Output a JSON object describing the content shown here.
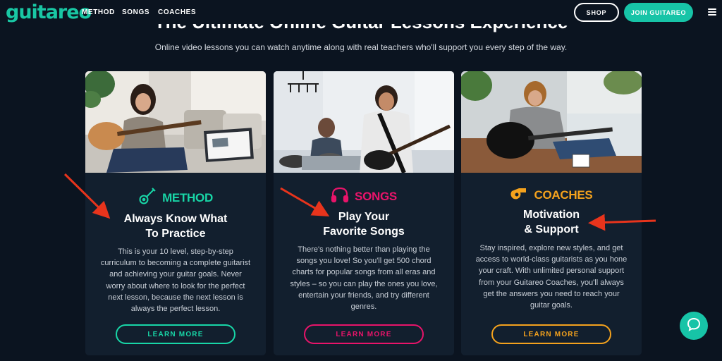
{
  "nav": {
    "logo": "guitareo",
    "links": [
      "METHOD",
      "SONGS",
      "COACHES"
    ],
    "shop": "SHOP",
    "join": "JOIN GUITAREO"
  },
  "hero": {
    "headline": "The Ultimate Online Guitar Lessons Experience",
    "subline": "Online video lessons you can watch anytime along with real teachers who'll support you every step of the way."
  },
  "colors": {
    "method": "#18d6a7",
    "songs": "#e8146a",
    "coaches": "#f4a21d",
    "accent": "#17c4a7"
  },
  "cards": [
    {
      "icon": "guitar-icon",
      "label": "METHOD",
      "heading_line1": "Always Know What",
      "heading_line2": "To Practice",
      "body": "This is your 10 level, step-by-step curriculum to becoming a complete guitarist and achieving your guitar goals. Never worry about where to look for the perfect next lesson, because the next lesson is always the perfect lesson.",
      "button": "LEARN MORE"
    },
    {
      "icon": "headphones-icon",
      "label": "SONGS",
      "heading_line1": "Play Your",
      "heading_line2": "Favorite Songs",
      "body": "There's nothing better than playing the songs you love! So you'll get 500 chord charts for popular songs from all eras and styles – so you can play the ones you love, entertain your friends, and try different genres.",
      "button": "LEARN MORE"
    },
    {
      "icon": "whistle-icon",
      "label": "COACHES",
      "heading_line1": "Motivation",
      "heading_line2": "& Support",
      "body": "Stay inspired, explore new styles, and get access to world-class guitarists as you hone your craft. With unlimited personal support from your Guitareo Coaches, you'll always get the answers you need to reach your guitar goals.",
      "button": "LEARN MORE"
    }
  ]
}
